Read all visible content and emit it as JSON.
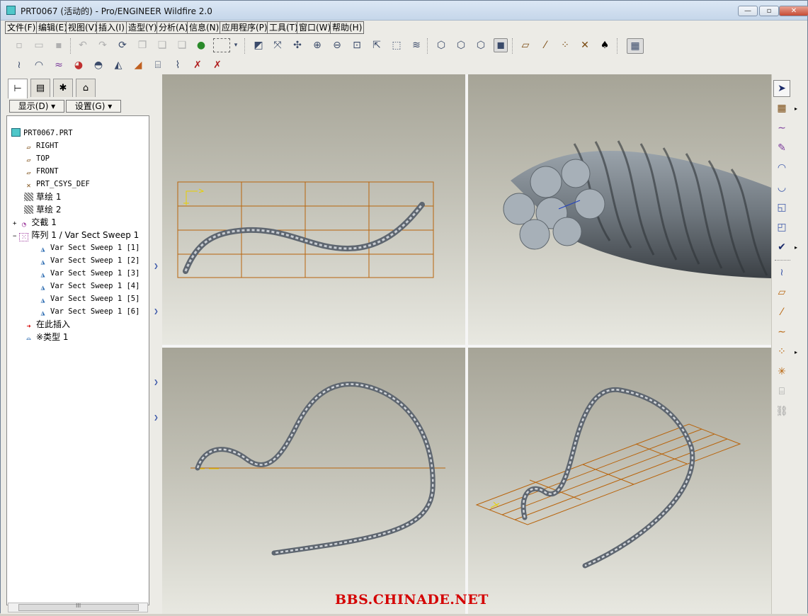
{
  "window": {
    "title": "PRT0067 (活动的) - Pro/ENGINEER Wildfire 2.0",
    "minimize": "—",
    "maximize": "▫",
    "close": "✕"
  },
  "menu": [
    "文件(F)",
    "编辑(E)",
    "视图(V)",
    "插入(I)",
    "造型(Y)",
    "分析(A)",
    "信息(N)",
    "应用程序(P)",
    "工具(T)",
    "窗口(W)",
    "帮助(H)"
  ],
  "left_panel": {
    "show_dropdown": "显示(D) ▾",
    "settings_dropdown": "设置(G) ▾"
  },
  "model_tree": [
    {
      "label": "PRT0067.PRT",
      "icon": "part-icon",
      "level": 0
    },
    {
      "label": "RIGHT",
      "icon": "datum-plane-icon",
      "level": 1
    },
    {
      "label": "TOP",
      "icon": "datum-plane-icon",
      "level": 1
    },
    {
      "label": "FRONT",
      "icon": "datum-plane-icon",
      "level": 1
    },
    {
      "label": "PRT_CSYS_DEF",
      "icon": "csys-icon",
      "level": 1
    },
    {
      "label": "草绘 1",
      "icon": "sketch-icon",
      "level": 1
    },
    {
      "label": "草绘 2",
      "icon": "sketch-icon",
      "level": 1
    },
    {
      "label": "交截 1",
      "icon": "intersect-icon",
      "level": 1,
      "expander": "+"
    },
    {
      "label": "阵列 1 / Var Sect Sweep 1",
      "icon": "pattern-icon",
      "level": 1,
      "expander": "−"
    },
    {
      "label": "Var Sect Sweep 1 [1]",
      "icon": "sweep-icon",
      "level": 2
    },
    {
      "label": "Var Sect Sweep 1 [2]",
      "icon": "sweep-icon",
      "level": 2
    },
    {
      "label": "Var Sect Sweep 1 [3]",
      "icon": "sweep-icon",
      "level": 2
    },
    {
      "label": "Var Sect Sweep 1 [4]",
      "icon": "sweep-icon",
      "level": 2
    },
    {
      "label": "Var Sect Sweep 1 [5]",
      "icon": "sweep-icon",
      "level": 2
    },
    {
      "label": "Var Sect Sweep 1 [6]",
      "icon": "sweep-icon",
      "level": 2
    },
    {
      "label": "在此插入",
      "icon": "insert-here-arrow-icon",
      "level": 1
    },
    {
      "label": "※类型 1",
      "icon": "style-icon",
      "level": 0
    }
  ],
  "hscroll_label": "III",
  "watermark": "BBS.CHINADE.NET",
  "colors": {
    "datum_orange": "#b8640c",
    "wire_steel": "#8c939b",
    "csys_yellow": "#e8d000",
    "watermark_red": "#d40000"
  }
}
